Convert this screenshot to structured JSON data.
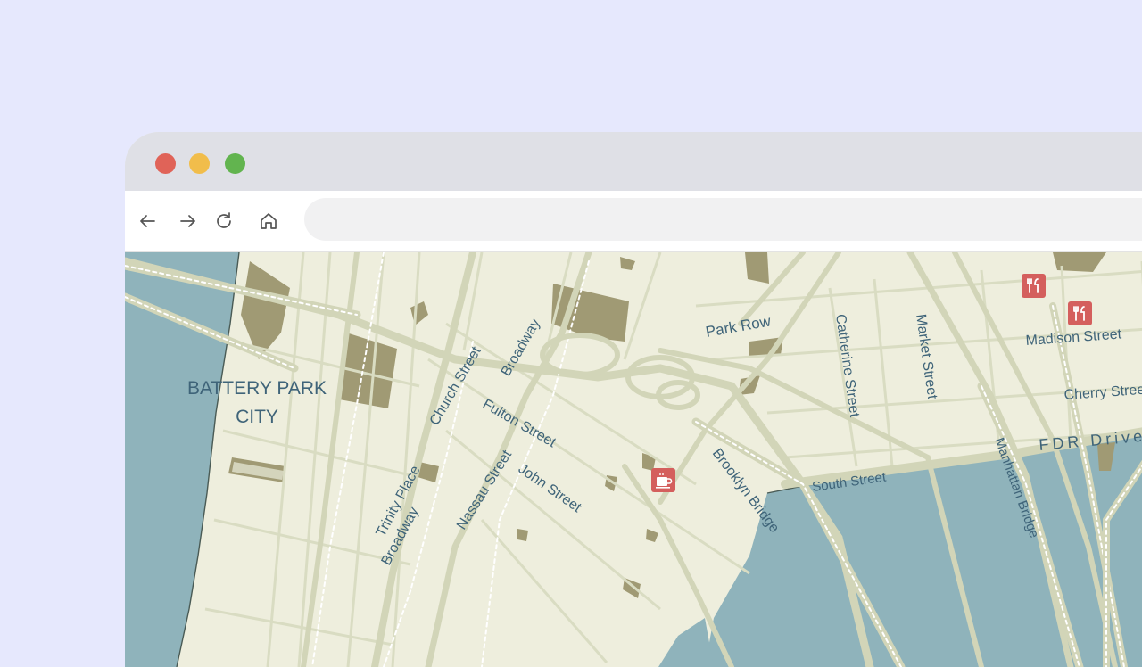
{
  "browser": {
    "address_value": "",
    "controls": {
      "back_icon": "arrow-left",
      "forward_icon": "arrow-right",
      "reload_icon": "reload",
      "home_icon": "home"
    }
  },
  "map": {
    "district_label_line1": "BATTERY PARK",
    "district_label_line2": "CITY",
    "streets": {
      "park_row": "Park Row",
      "church_street": "Church Street",
      "broadway_north": "Broadway",
      "fulton_street": "Fulton Street",
      "trinity_place": "Trinity Place",
      "broadway_south": "Broadway",
      "nassau_street": "Nassau Street",
      "john_street": "John Street",
      "brooklyn_bridge": "Brooklyn Bridge",
      "catherine_street": "Catherine Street",
      "market_street": "Market Street",
      "madison_street": "Madison Street",
      "cherry_street": "Cherry Street",
      "fdr_drive": "FDR Drive",
      "south_street": "South Street",
      "manhattan_bridge": "Manhattan Bridge"
    },
    "pois": [
      {
        "type": "restaurant",
        "icon": "fork-knife-icon"
      },
      {
        "type": "restaurant",
        "icon": "fork-knife-icon"
      },
      {
        "type": "cafe",
        "icon": "coffee-cup-icon"
      }
    ],
    "colors": {
      "water": "#8fb3bb",
      "land": "#eeeedd",
      "park": "#a09a74",
      "road": "#d9dcc2",
      "poi": "#d45f5d",
      "label": "#3f6479"
    }
  }
}
